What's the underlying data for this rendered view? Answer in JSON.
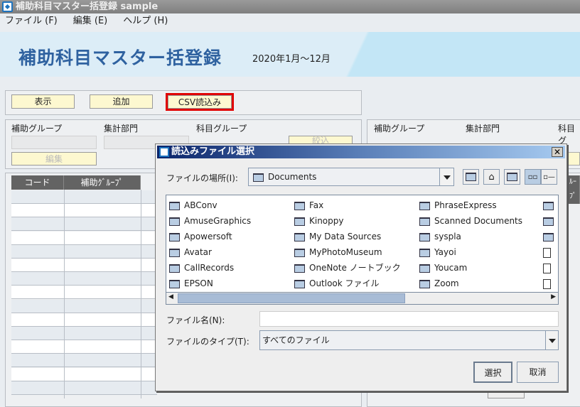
{
  "window": {
    "title": "補助科目マスター括登録 sample"
  },
  "menu": [
    "ファイル (F)",
    "編集 (E)",
    "ヘルプ (H)"
  ],
  "banner": {
    "title": "補助科目マスター括登録",
    "period": "2020年1月〜12月"
  },
  "toolbar": {
    "show": "表示",
    "add": "追加",
    "csv": "CSV読込み"
  },
  "filters": {
    "sub_group": "補助グループ",
    "dept": "集計部門",
    "account_group": "科目グループ",
    "edit": "編集",
    "narrow": "絞込",
    "account_group_short": "科目グ"
  },
  "table": {
    "headers": [
      "コード",
      "補助ｸﾞﾙｰﾌﾟ"
    ],
    "right_header_fragment": "ﾙｰﾌﾟ"
  },
  "dialog": {
    "title": "読込みファイル選択",
    "location_label": "ファイルの場所(I):",
    "location_value": "Documents",
    "files": [
      [
        "ABConv",
        "AmuseGraphics",
        "Apowersoft",
        "Avatar",
        "CallRecords",
        "EPSON"
      ],
      [
        "Fax",
        "Kinoppy",
        "My Data Sources",
        "MyPhotoMuseum",
        "OneNote ノートブック",
        "Outlook ファイル"
      ],
      [
        "PhraseExpress",
        "Scanned Documents",
        "syspla",
        "Yayoi",
        "Youcam",
        "Zoom"
      ]
    ],
    "filename_label": "ファイル名(N):",
    "filename_value": "",
    "filetype_label": "ファイルのタイプ(T):",
    "filetype_value": "すべてのファイル",
    "select": "選択",
    "cancel": "取消",
    "scroll_position": 0.05
  },
  "colors": {
    "highlight": "#e00000",
    "banner_title": "#2f62a0",
    "button_yellow": "#fdf8d0"
  }
}
